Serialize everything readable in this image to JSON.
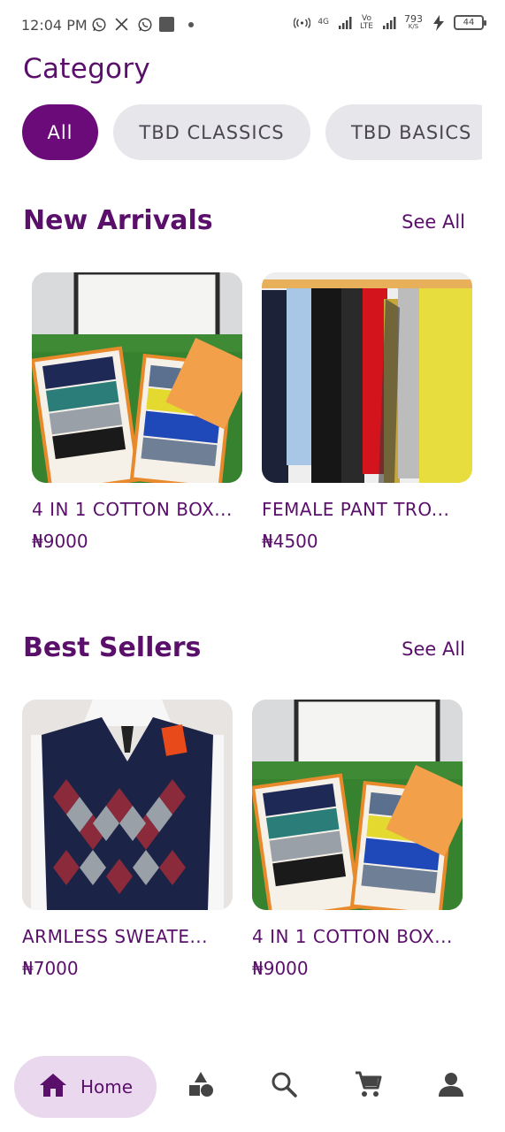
{
  "status_bar": {
    "time": "12:04 PM",
    "network": "4G",
    "volte": "Vo\nLTE",
    "speed_value": "793",
    "speed_unit": "K/S",
    "battery": "44"
  },
  "category": {
    "title": "Category",
    "chips": [
      {
        "label": "All",
        "active": true
      },
      {
        "label": "TBD CLASSICS",
        "active": false
      },
      {
        "label": "TBD BASICS",
        "active": false
      }
    ]
  },
  "new_arrivals": {
    "title": "New Arrivals",
    "see_all": "See All",
    "products": [
      {
        "name": "4 IN 1 COTTON BOX...",
        "price": "₦9000",
        "image": "boxer-pack-photo"
      },
      {
        "name": "FEMALE PANT TRO...",
        "price": "₦4500",
        "image": "trousers-rack-photo"
      }
    ]
  },
  "best_sellers": {
    "title": "Best Sellers",
    "see_all": "See All",
    "products": [
      {
        "name": "ARMLESS SWEATE...",
        "price": "₦7000",
        "image": "argyle-sweater-photo"
      },
      {
        "name": "4 IN 1 COTTON BOX...",
        "price": "₦9000",
        "image": "boxer-pack-photo"
      }
    ]
  },
  "bottom_nav": {
    "home_label": "Home",
    "items": [
      "home-icon",
      "category-icon",
      "search-icon",
      "cart-icon",
      "profile-icon"
    ]
  },
  "colors": {
    "brand": "#5a0f6b",
    "active_chip": "#6b0a79",
    "chip_bg": "#e7e6eb",
    "nav_highlight": "#ead8ee"
  }
}
